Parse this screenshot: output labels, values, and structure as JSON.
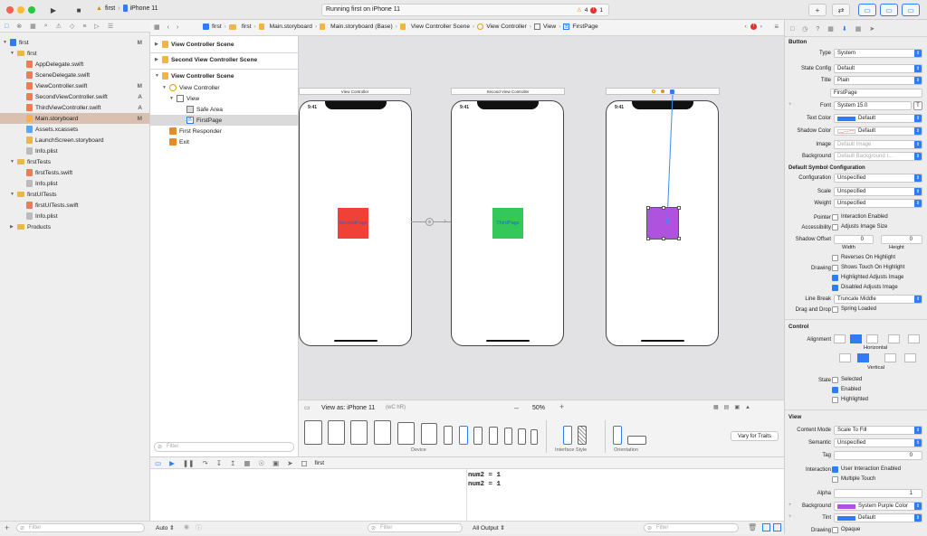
{
  "toolbar": {
    "scheme": "first",
    "device": "iPhone 11",
    "status": "Running first on iPhone 11",
    "warnings": "4",
    "errors": "1"
  },
  "breadcrumb": [
    "first",
    "first",
    "Main.storyboard",
    "Main.storyboard (Base)",
    "View Controller Scene",
    "View Controller",
    "View",
    "FirstPage"
  ],
  "navigator": {
    "items": [
      {
        "label": "first",
        "badge": "M",
        "kind": "project",
        "depth": 0
      },
      {
        "label": "first",
        "badge": "",
        "kind": "folder",
        "depth": 1
      },
      {
        "label": "AppDelegate.swift",
        "badge": "",
        "kind": "swift",
        "depth": 2
      },
      {
        "label": "SceneDelegate.swift",
        "badge": "",
        "kind": "swift",
        "depth": 2
      },
      {
        "label": "ViewController.swift",
        "badge": "M",
        "kind": "swift",
        "depth": 2
      },
      {
        "label": "SecondViewController.swift",
        "badge": "A",
        "kind": "swift",
        "depth": 2
      },
      {
        "label": "ThirdViewController.swift",
        "badge": "A",
        "kind": "swift",
        "depth": 2
      },
      {
        "label": "Main.storyboard",
        "badge": "M",
        "kind": "storyboard",
        "depth": 2
      },
      {
        "label": "Assets.xcassets",
        "badge": "",
        "kind": "assets",
        "depth": 2
      },
      {
        "label": "LaunchScreen.storyboard",
        "badge": "",
        "kind": "storyboard",
        "depth": 2
      },
      {
        "label": "Info.plist",
        "badge": "",
        "kind": "plist",
        "depth": 2
      },
      {
        "label": "firstTests",
        "badge": "",
        "kind": "folder",
        "depth": 1
      },
      {
        "label": "firstTests.swift",
        "badge": "",
        "kind": "swift",
        "depth": 2
      },
      {
        "label": "Info.plist",
        "badge": "",
        "kind": "plist",
        "depth": 2
      },
      {
        "label": "firstUITests",
        "badge": "",
        "kind": "folder",
        "depth": 1
      },
      {
        "label": "firstUITests.swift",
        "badge": "",
        "kind": "swift",
        "depth": 2
      },
      {
        "label": "Info.plist",
        "badge": "",
        "kind": "plist",
        "depth": 2
      },
      {
        "label": "Products",
        "badge": "",
        "kind": "folder",
        "depth": 1
      }
    ],
    "filter_placeholder": "Filter"
  },
  "outline": {
    "items": [
      {
        "label": "View Controller Scene",
        "depth": 0,
        "bold": true
      },
      {
        "label": "Second View Controller Scene",
        "depth": 0,
        "bold": true
      },
      {
        "label": "View Controller Scene",
        "depth": 0,
        "bold": true
      },
      {
        "label": "View Controller",
        "depth": 1,
        "bold": false
      },
      {
        "label": "View",
        "depth": 2,
        "bold": false
      },
      {
        "label": "Safe Area",
        "depth": 3,
        "bold": false
      },
      {
        "label": "FirstPage",
        "depth": 3,
        "bold": false
      },
      {
        "label": "First Responder",
        "depth": 1,
        "bold": false
      },
      {
        "label": "Exit",
        "depth": 1,
        "bold": false
      }
    ],
    "filter_placeholder": "Filter"
  },
  "canvas": {
    "scenes": [
      {
        "title": "View Controller",
        "button": "SecondPage",
        "color": "#f04137"
      },
      {
        "title": "Second View Controller",
        "button": "ThirdPage",
        "color": "#34c759"
      },
      {
        "title": "",
        "button": "",
        "color": "#af52de"
      }
    ],
    "time": "9:41"
  },
  "devicebar": {
    "view_as": "View as: iPhone 11",
    "view_as_shortcut": "(wC hR)",
    "zoom": "50%",
    "device_label": "Device",
    "interface_label": "Interface Style",
    "orientation_label": "Orientation",
    "vary_button": "Vary for Traits"
  },
  "debug": {
    "target": "first",
    "console_lines": [
      "num2 = 1",
      "num2 = 1"
    ],
    "auto": "Auto",
    "all_output": "All Output",
    "filter_placeholder": "Filter"
  },
  "inspector": {
    "button_section": "Button",
    "rows": [
      {
        "label": "Type",
        "value": "System"
      },
      {
        "label": "State Config",
        "value": "Default"
      },
      {
        "label": "Title",
        "value": "Plain"
      }
    ],
    "title_text": "FirstPage",
    "font_label": "Font",
    "font_value": "System 15.0",
    "text_color_label": "Text Color",
    "text_color": "Default",
    "shadow_color_label": "Shadow Color",
    "shadow_color": "Default",
    "image_label": "Image",
    "image_placeholder": "Default Image",
    "background_label": "Background",
    "background_placeholder": "Default Background I...",
    "symbol_section": "Default Symbol Configuration",
    "configuration_label": "Configuration",
    "configuration": "Unspecified",
    "scale_label": "Scale",
    "scale": "Unspecified",
    "weight_label": "Weight",
    "weight": "Unspecified",
    "pointer_label": "Pointer",
    "pointer": "Interaction Enabled",
    "accessibility_label": "Accessibility",
    "accessibility": "Adjusts Image Size",
    "shadow_offset_label": "Shadow Offset",
    "shadow_w": "0",
    "shadow_h": "0",
    "width_label": "Width",
    "height_label": "Height",
    "reverses": "Reverses On Highlight",
    "drawing_label": "Drawing",
    "shows_touch": "Shows Touch On Highlight",
    "highlighted_adjusts": "Highlighted Adjusts Image",
    "disabled_adjusts": "Disabled Adjusts Image",
    "line_break_label": "Line Break",
    "line_break": "Truncate Middle",
    "drag_drop_label": "Drag and Drop",
    "drag_drop": "Spring Loaded",
    "control_section": "Control",
    "alignment_label": "Alignment",
    "horizontal_label": "Horizontal",
    "vertical_label": "Vertical",
    "state_label": "State",
    "selected": "Selected",
    "enabled": "Enabled",
    "highlighted": "Highlighted",
    "view_section": "View",
    "content_mode_label": "Content Mode",
    "content_mode": "Scale To Fill",
    "semantic_label": "Semantic",
    "semantic": "Unspecified",
    "tag_label": "Tag",
    "tag": "0",
    "interaction_label": "Interaction",
    "user_interaction": "User Interaction Enabled",
    "multiple_touch": "Multiple Touch",
    "alpha_label": "Alpha",
    "alpha": "1",
    "bg_label": "Background",
    "bg_value": "System Purple Color",
    "tint_label": "Tint",
    "tint": "Default",
    "drawing2_label": "Drawing",
    "opaque": "Opaque"
  },
  "colors": {
    "accent": "#2f7cf6",
    "selection": "#d9d9d9",
    "purple": "#af52de"
  }
}
